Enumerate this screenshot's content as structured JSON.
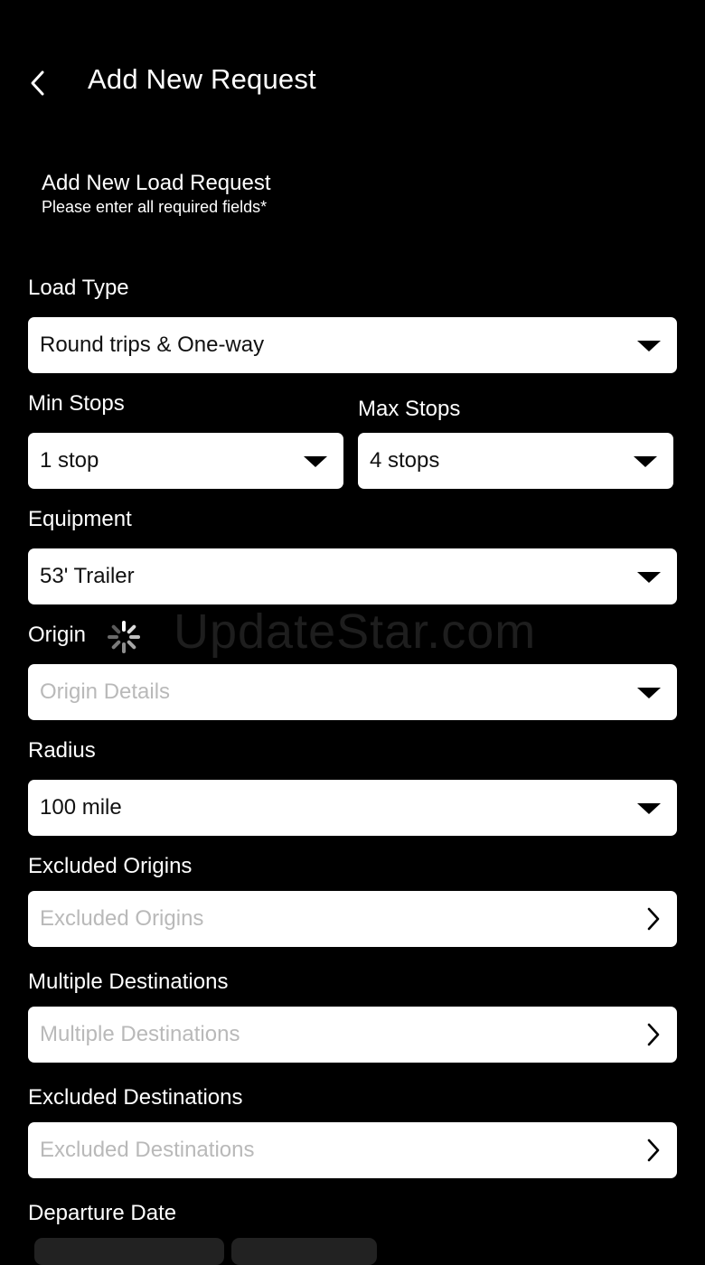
{
  "header": {
    "back_icon": "chevron-left-icon",
    "title": "Add New Request"
  },
  "intro": {
    "title": "Add New Load Request",
    "subtitle": "Please enter all required fields*"
  },
  "form": {
    "load_type": {
      "label": "Load Type",
      "value": "Round trips & One-way"
    },
    "min_stops": {
      "label": "Min Stops",
      "value": "1 stop"
    },
    "max_stops": {
      "label": "Max Stops",
      "value": "4 stops"
    },
    "equipment": {
      "label": "Equipment",
      "value": "53' Trailer"
    },
    "origin": {
      "label": "Origin",
      "placeholder": "Origin Details",
      "loading_icon": "spinner-icon"
    },
    "radius": {
      "label": "Radius",
      "value": "100 mile"
    },
    "excluded_origins": {
      "label": "Excluded Origins",
      "placeholder": "Excluded Origins"
    },
    "multiple_destinations": {
      "label": "Multiple Destinations",
      "placeholder": "Multiple Destinations"
    },
    "excluded_destinations": {
      "label": "Excluded Destinations",
      "placeholder": "Excluded Destinations"
    },
    "departure_date": {
      "label": "Departure Date"
    }
  },
  "watermark": "UpdateStar.com",
  "colors": {
    "background": "#000000",
    "field_bg": "#ffffff",
    "placeholder": "#b9b9b9",
    "text": "#ffffff"
  }
}
